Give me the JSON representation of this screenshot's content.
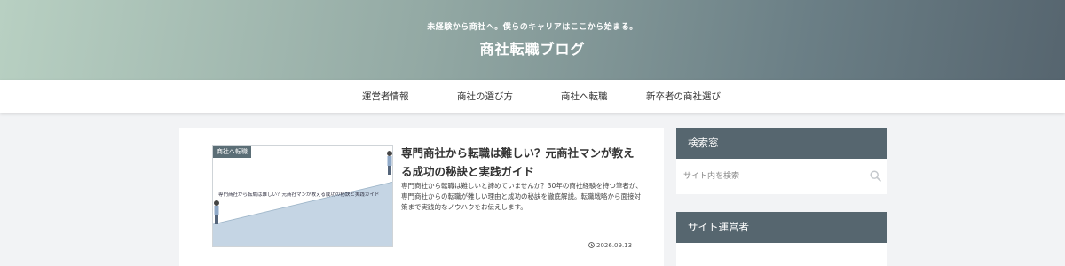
{
  "header": {
    "tagline": "未経験から商社へ。僕らのキャリアはここから始まる。",
    "site_title": "商社転職ブログ"
  },
  "nav": {
    "items": [
      {
        "label": "運営者情報"
      },
      {
        "label": "商社の選び方"
      },
      {
        "label": "商社へ転職"
      },
      {
        "label": "新卒者の商社選び"
      }
    ]
  },
  "article": {
    "category": "商社へ転職",
    "thumbnail_text": "専門商社から転職は難しい？元商社マンが教える成功の秘訣と実践ガイド",
    "title": "専門商社から転職は難しい？元商社マンが教える成功の秘訣と実践ガイド",
    "excerpt": "専門商社から転職は難しいと諦めていませんか？30年の商社経験を持つ筆者が、専門商社からの転職が難しい理由と成功の秘訣を徹底解説。転職戦略から面接対策まで実践的なノウハウをお伝えします。",
    "date": "2026.09.13"
  },
  "sidebar": {
    "search_title": "検索窓",
    "search_placeholder": "サイト内を検索",
    "operator_title": "サイト運営者"
  },
  "colors": {
    "widget_header": "#56666f",
    "accent_blue": "#c5d5e4"
  }
}
